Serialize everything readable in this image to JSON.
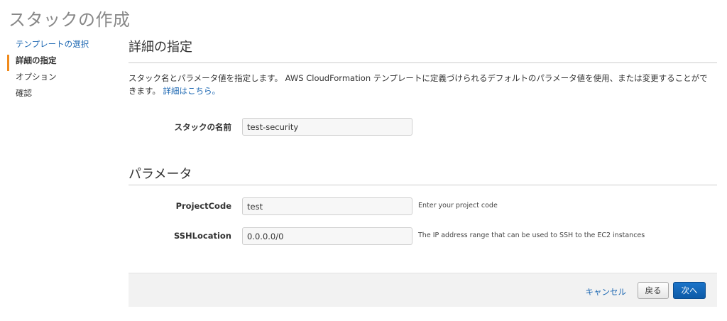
{
  "page": {
    "title": "スタックの作成"
  },
  "sidebar": {
    "items": [
      {
        "label": "テンプレートの選択",
        "state": "link"
      },
      {
        "label": "詳細の指定",
        "state": "active"
      },
      {
        "label": "オプション",
        "state": "normal"
      },
      {
        "label": "確認",
        "state": "normal"
      }
    ]
  },
  "details": {
    "heading": "詳細の指定",
    "description": "スタック名とパラメータ値を指定します。 AWS CloudFormation テンプレートに定義づけられるデフォルトのパラメータ値を使用、または変更することができます。",
    "more_link": "詳細はこちら。",
    "stack_name": {
      "label": "スタックの名前",
      "value": "test-security"
    }
  },
  "parameters": {
    "heading": "パラメータ",
    "fields": [
      {
        "label": "ProjectCode",
        "value": "test",
        "hint": "Enter your project code"
      },
      {
        "label": "SSHLocation",
        "value": "0.0.0.0/0",
        "hint": "The IP address range that can be used to SSH to the EC2 instances"
      }
    ]
  },
  "footer": {
    "cancel_label": "キャンセル",
    "back_label": "戻る",
    "next_label": "次へ"
  },
  "colors": {
    "accent": "#f08a1c",
    "link": "#1f69b3",
    "primary_button": "#0d5aa7"
  }
}
